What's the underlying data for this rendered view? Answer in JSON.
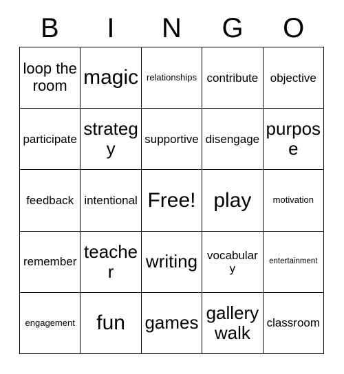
{
  "card": {
    "title_letters": [
      "B",
      "I",
      "N",
      "G",
      "O"
    ],
    "columns": 5,
    "rows": 5,
    "free_space_label": "Free!",
    "grid_line_color": "#000000",
    "background_color": "#ffffff",
    "text_color": "#000000",
    "cells": [
      [
        {
          "text": "loop the room",
          "size": "l"
        },
        {
          "text": "magic",
          "size": "xxl"
        },
        {
          "text": "relationships",
          "size": "s"
        },
        {
          "text": "contribute",
          "size": "m"
        },
        {
          "text": "objective",
          "size": "m"
        }
      ],
      [
        {
          "text": "participate",
          "size": "m"
        },
        {
          "text": "strategy",
          "size": "xl"
        },
        {
          "text": "supportive",
          "size": "m"
        },
        {
          "text": "disengage",
          "size": "m"
        },
        {
          "text": "purpose",
          "size": "xl"
        }
      ],
      [
        {
          "text": "feedback",
          "size": "m"
        },
        {
          "text": "intentional",
          "size": "m"
        },
        {
          "text": "Free!",
          "size": "xxl"
        },
        {
          "text": "play",
          "size": "xxl"
        },
        {
          "text": "motivation",
          "size": "s"
        }
      ],
      [
        {
          "text": "remember",
          "size": "m"
        },
        {
          "text": "teacher",
          "size": "xl"
        },
        {
          "text": "writing",
          "size": "xl"
        },
        {
          "text": "vocabulary",
          "size": "m"
        },
        {
          "text": "entertainment",
          "size": "xs"
        }
      ],
      [
        {
          "text": "engagement",
          "size": "s"
        },
        {
          "text": "fun",
          "size": "xxl"
        },
        {
          "text": "games",
          "size": "xl"
        },
        {
          "text": "gallery walk",
          "size": "xl"
        },
        {
          "text": "classroom",
          "size": "m"
        }
      ]
    ]
  }
}
